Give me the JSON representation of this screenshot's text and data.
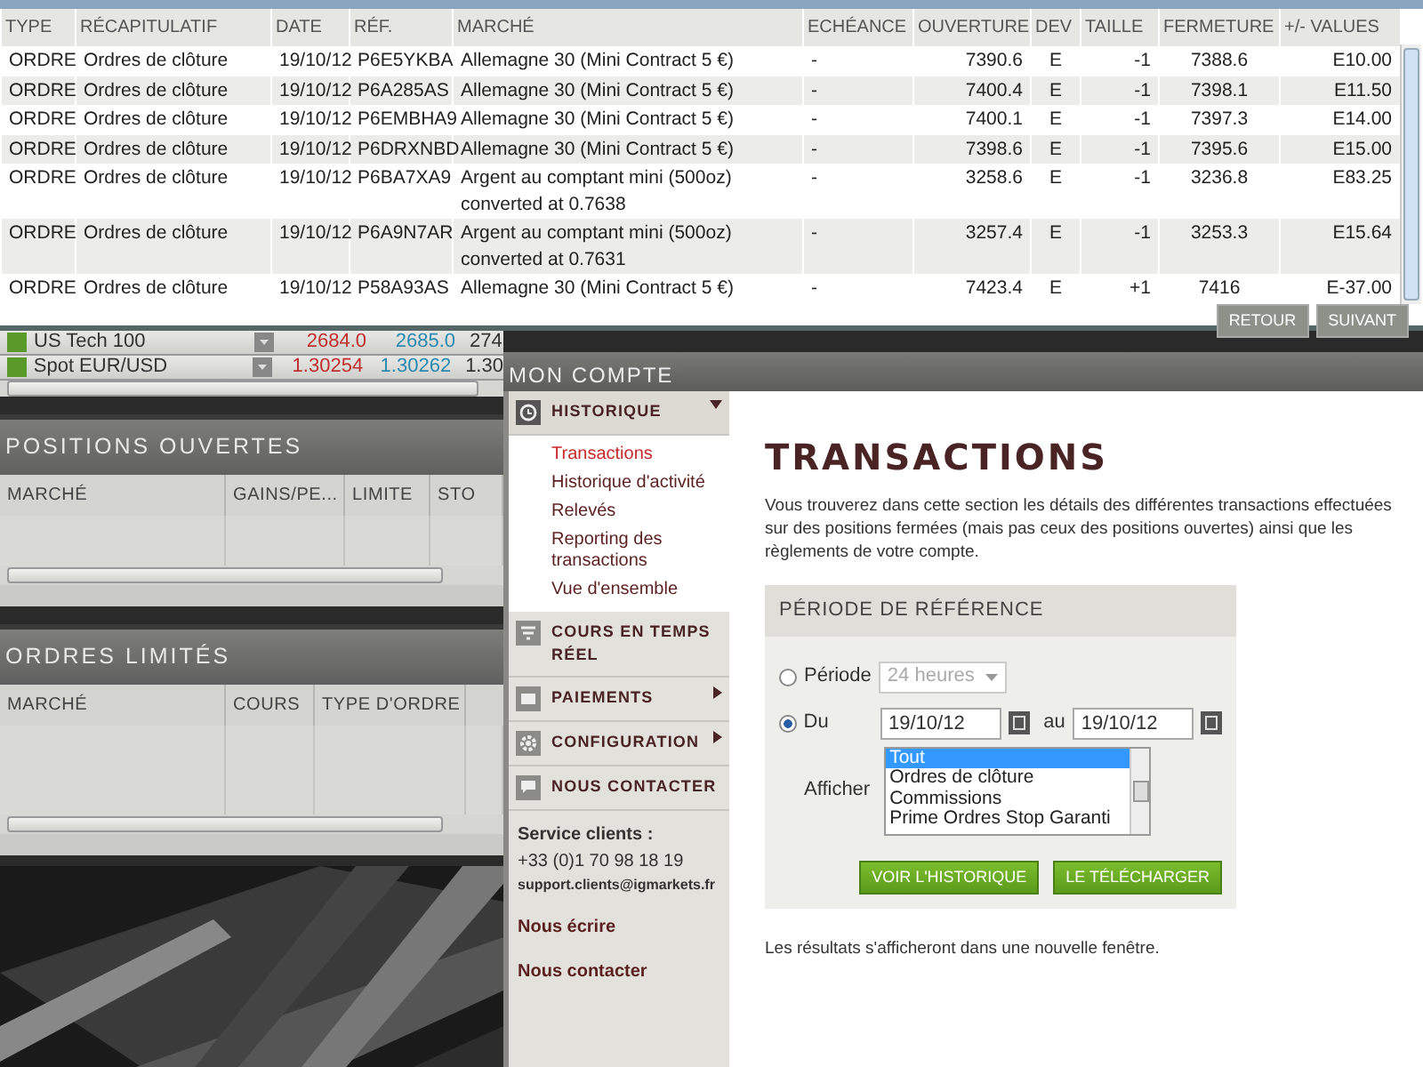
{
  "history_window": {
    "columns": [
      "TYPE",
      "RÉCAPITULATIF",
      "DATE",
      "RÉF.",
      "MARCHÉ",
      "ECHÉANCE",
      "OUVERTURE",
      "DEV",
      "TAILLE",
      "FERMETURE",
      "+/- VALUES"
    ],
    "rows": [
      {
        "cells": [
          "ORDRE",
          "Ordres de clôture",
          "19/10/12",
          "P6E5YKBA",
          "Allemagne 30 (Mini Contract 5 €)",
          "-",
          "7390.6",
          "E",
          "-1",
          "7388.6",
          "E10.00"
        ]
      },
      {
        "cells": [
          "ORDRE",
          "Ordres de clôture",
          "19/10/12",
          "P6A285AS",
          "Allemagne 30 (Mini Contract 5 €)",
          "-",
          "7400.4",
          "E",
          "-1",
          "7398.1",
          "E11.50"
        ]
      },
      {
        "cells": [
          "ORDRE",
          "Ordres de clôture",
          "19/10/12",
          "P6EMBHA9",
          "Allemagne 30 (Mini Contract 5 €)",
          "-",
          "7400.1",
          "E",
          "-1",
          "7397.3",
          "E14.00"
        ]
      },
      {
        "cells": [
          "ORDRE",
          "Ordres de clôture",
          "19/10/12",
          "P6DRXNBD",
          "Allemagne 30 (Mini Contract 5 €)",
          "-",
          "7398.6",
          "E",
          "-1",
          "7395.6",
          "E15.00"
        ]
      },
      {
        "cells": [
          "ORDRE",
          "Ordres de clôture",
          "19/10/12",
          "P6BA7XA9",
          "Argent au comptant mini (500oz) converted at 0.7638",
          "-",
          "3258.6",
          "E",
          "-1",
          "3236.8",
          "E83.25"
        ]
      },
      {
        "cells": [
          "ORDRE",
          "Ordres de clôture",
          "19/10/12",
          "P6A9N7AR",
          "Argent au comptant mini (500oz) converted at 0.7631",
          "-",
          "3257.4",
          "E",
          "-1",
          "3253.3",
          "E15.64"
        ]
      },
      {
        "cells": [
          "ORDRE",
          "Ordres de clôture",
          "19/10/12",
          "P58A93AS",
          "Allemagne 30 (Mini Contract 5 €)",
          "-",
          "7423.4",
          "E",
          "+1",
          "7416",
          "E-37.00"
        ]
      }
    ],
    "buttons": [
      "RETOUR",
      "SUIVANT"
    ]
  },
  "markets": [
    {
      "name": "US Tech 100",
      "sell": "2684.0",
      "buy": "2685.0",
      "column_4": "274"
    },
    {
      "name": "Spot EUR/USD",
      "sell": "1.30254",
      "buy": "1.30262",
      "column_4": "1.30"
    }
  ],
  "positions_panel": {
    "title": "POSITIONS OUVERTES",
    "columns": [
      "MARCHÉ",
      "GAINS/PE...",
      "LIMITE",
      "STO"
    ]
  },
  "orders_panel": {
    "title": "ORDRES LIMITÉS",
    "columns": [
      "MARCHÉ",
      "COURS",
      "TYPE D'ORDRE"
    ]
  },
  "account": {
    "title": "MON COMPTE",
    "menu": [
      {
        "label": "HISTORIQUE",
        "kind": "history",
        "expanded": true,
        "children": [
          {
            "label": "Transactions",
            "selected": true
          },
          {
            "label": "Historique d'activité",
            "selected": false
          },
          {
            "label": "Relevés",
            "selected": false
          },
          {
            "label": "Reporting des transactions",
            "selected": false
          },
          {
            "label": "Vue d'ensemble",
            "selected": false
          }
        ]
      },
      {
        "label": "COURS EN TEMPS RÉEL",
        "kind": "filter"
      },
      {
        "label": "PAIEMENTS",
        "kind": "card",
        "expanded": false
      },
      {
        "label": "CONFIGURATION",
        "kind": "gear",
        "expanded": false
      },
      {
        "label": "NOUS CONTACTER",
        "kind": "chat"
      }
    ],
    "contact": {
      "title": "Service clients :",
      "phone": "+33 (0)1 70 98 18 19",
      "email": "support.clients@igmarkets.fr",
      "links": [
        "Nous écrire",
        "Nous contacter"
      ]
    },
    "heading": "TRANSACTIONS",
    "description": "Vous trouverez dans cette section les détails des différentes transactions effectuées sur des positions fermées (mais pas ceux des positions ouvertes) ainsi que les règlements de votre compte.",
    "form": {
      "title": "PÉRIODE DE RÉFÉRENCE",
      "period": {
        "label": "Période",
        "selected": false,
        "value": "24 heures",
        "disabled": true
      },
      "range": {
        "label": "Du",
        "selected": true,
        "from": "19/10/12",
        "to_label": "au",
        "to": "19/10/12"
      },
      "show": {
        "label": "Afficher",
        "options": [
          {
            "label": "Tout",
            "selected": true
          },
          {
            "label": "Ordres de clôture",
            "selected": false
          },
          {
            "label": "Commissions",
            "selected": false
          },
          {
            "label": "Prime Ordres Stop Garanti",
            "selected": false
          }
        ]
      },
      "buttons": [
        "VOIR L'HISTORIQUE",
        "LE TÉLÉCHARGER"
      ]
    },
    "note": "Les résultats s'afficheront dans une nouvelle fenêtre."
  }
}
